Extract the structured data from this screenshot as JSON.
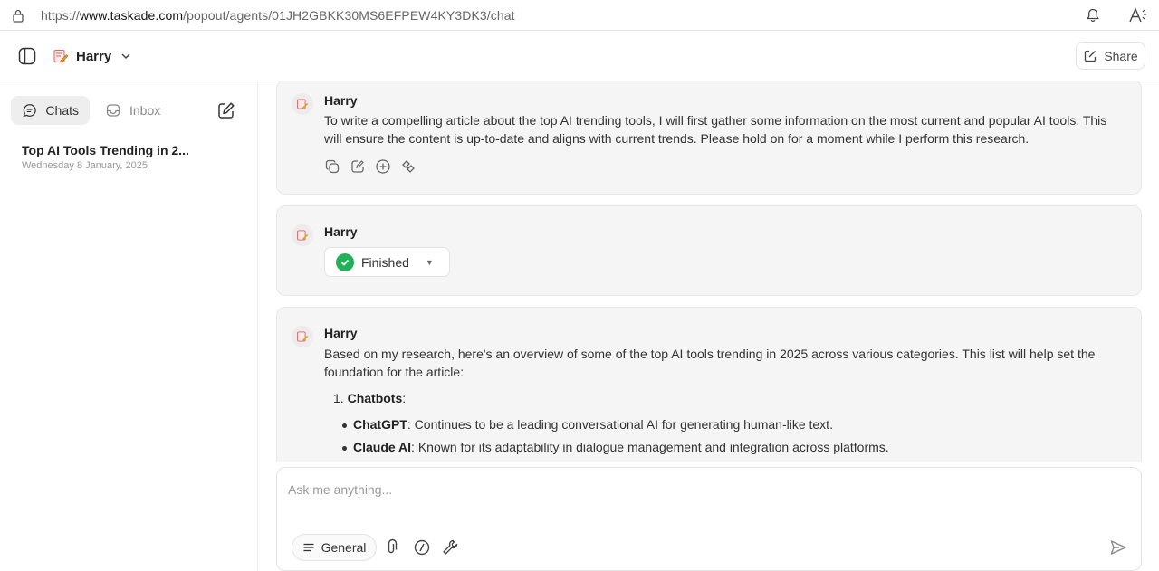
{
  "browser": {
    "url_prefix": "https://",
    "url_host": "www.taskade.com",
    "url_path": "/popout/agents/01JH2GBKK30MS6EFPEW4KY3DK3/chat"
  },
  "header": {
    "agent_name": "Harry",
    "share_label": "Share"
  },
  "sidebar": {
    "tabs": [
      {
        "label": "Chats",
        "icon": "chat-bubble-icon",
        "active": true
      },
      {
        "label": "Inbox",
        "icon": "inbox-icon",
        "active": false
      }
    ],
    "chats": [
      {
        "title": "Top AI Tools Trending in 2...",
        "date": "Wednesday 8 January, 2025"
      }
    ]
  },
  "messages": [
    {
      "author": "Harry",
      "text": "To write a compelling article about the top AI trending tools, I will first gather some information on the most current and popular AI tools. This will ensure the content is up-to-date and aligns with current trends. Please hold on for a moment while I perform this research."
    },
    {
      "author": "Harry",
      "status": "Finished"
    },
    {
      "author": "Harry",
      "text": "Based on my research, here's an overview of some of the top AI tools trending in 2025 across various categories. This list will help set the foundation for the article:",
      "list_number": "1.",
      "list_heading": "Chatbots",
      "list_heading_suffix": ":",
      "bullets": [
        {
          "name": "ChatGPT",
          "desc": ": Continues to be a leading conversational AI for generating human-like text."
        },
        {
          "name": "Claude AI",
          "desc": ": Known for its adaptability in dialogue management and integration across platforms."
        }
      ]
    }
  ],
  "composer": {
    "placeholder": "Ask me anything...",
    "mode_label": "General"
  },
  "colors": {
    "success": "#22b05a",
    "accent": "#e05252"
  }
}
